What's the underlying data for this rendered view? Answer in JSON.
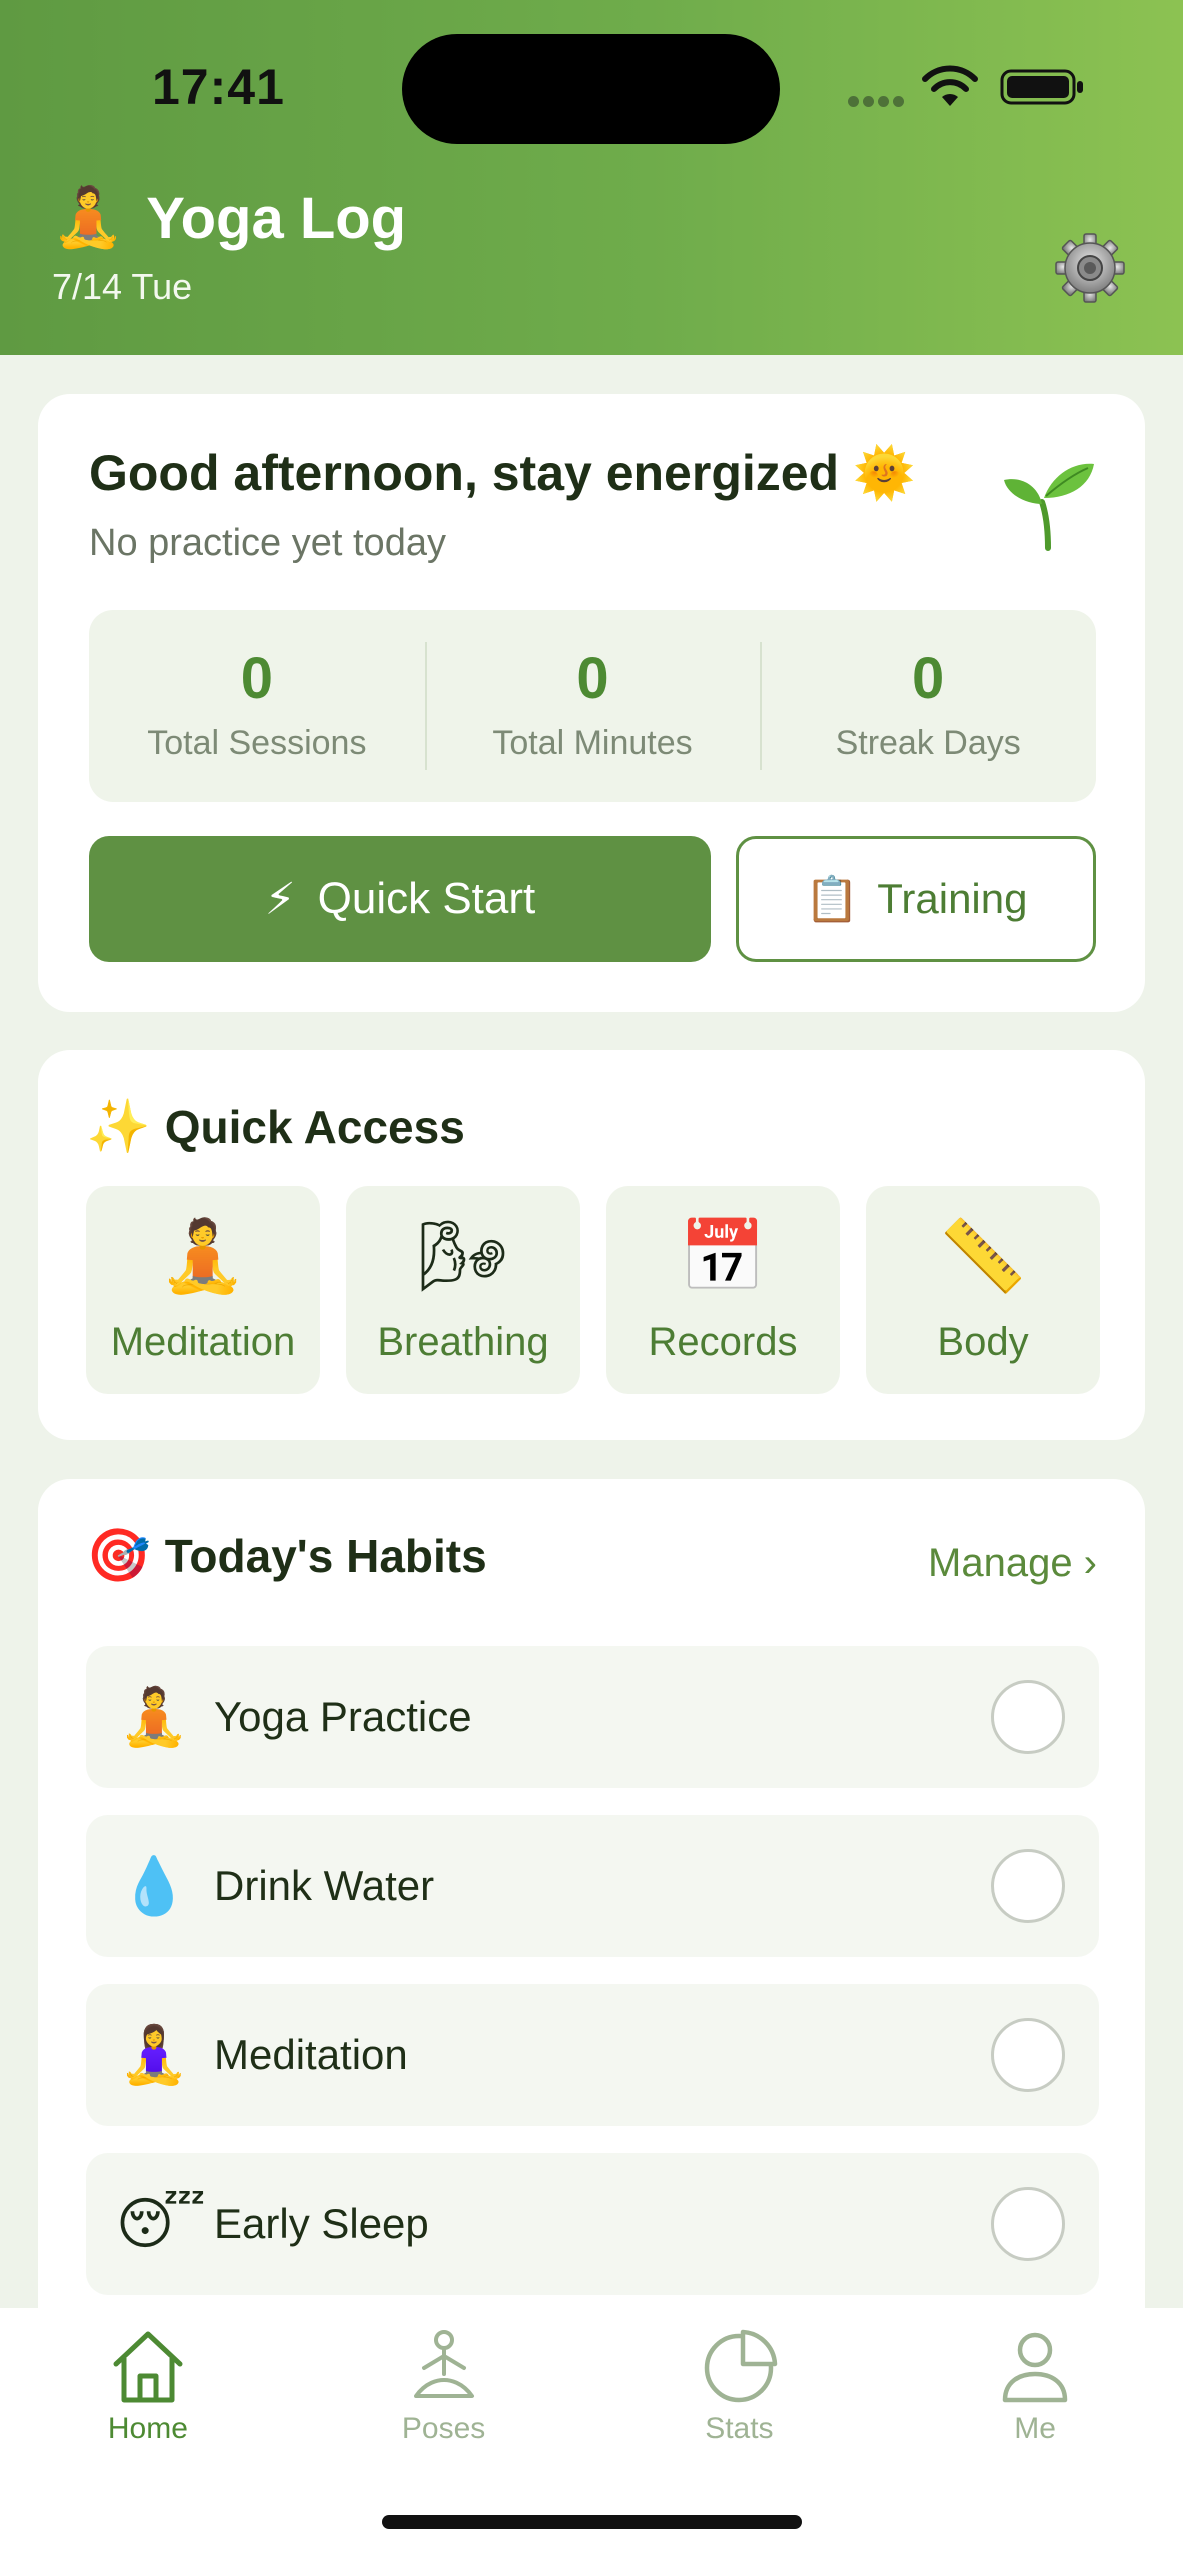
{
  "status_bar": {
    "time": "17:41"
  },
  "header": {
    "app_emoji": "🧘",
    "title": "Yoga Log",
    "date": "7/14 Tue",
    "settings_icon": "gear-icon"
  },
  "greeting": {
    "title": "Good afternoon, stay energized 🌞",
    "subtitle": "No practice yet today",
    "icon": "sprout-icon",
    "stats": [
      {
        "value": "0",
        "label": "Total Sessions"
      },
      {
        "value": "0",
        "label": "Total Minutes"
      },
      {
        "value": "0",
        "label": "Streak Days"
      }
    ],
    "quick_start": {
      "icon": "⚡",
      "label": "Quick Start"
    },
    "training": {
      "icon": "📋",
      "label": "Training"
    }
  },
  "quick_access": {
    "emoji": "✨",
    "title": "Quick Access",
    "items": [
      {
        "icon": "🧘",
        "label": "Meditation"
      },
      {
        "icon": "🌬",
        "label": "Breathing"
      },
      {
        "icon": "📅",
        "label": "Records"
      },
      {
        "icon": "📏",
        "label": "Body"
      }
    ]
  },
  "habits": {
    "emoji": "🎯",
    "title": "Today's Habits",
    "manage_label": "Manage ›",
    "items": [
      {
        "icon": "🧘",
        "label": "Yoga Practice",
        "done": false
      },
      {
        "icon": "💧",
        "label": "Drink Water",
        "done": false
      },
      {
        "icon": "🧘‍♀️",
        "label": "Meditation",
        "done": false
      },
      {
        "icon": "😴",
        "label": "Early Sleep",
        "done": false
      }
    ]
  },
  "tabbar": {
    "active": "Home",
    "tabs": [
      {
        "label": "Home",
        "icon": "home-icon"
      },
      {
        "label": "Poses",
        "icon": "pose-icon"
      },
      {
        "label": "Stats",
        "icon": "pie-chart-icon"
      },
      {
        "label": "Me",
        "icon": "person-icon"
      }
    ]
  },
  "colors": {
    "primary": "#5f9143",
    "header_gradient_start": "#5f9a42",
    "header_gradient_end": "#8cc252",
    "stat_value": "#4d8a33",
    "background": "#eef3ea"
  }
}
